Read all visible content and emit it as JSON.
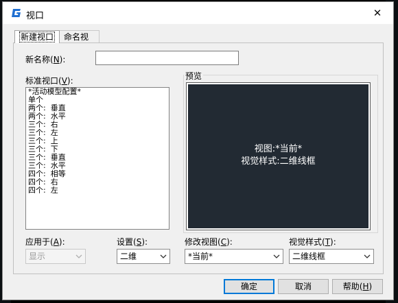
{
  "window": {
    "title": "视口",
    "close_symbol": "✕"
  },
  "tabs": [
    {
      "label": "新建视口",
      "active": true
    },
    {
      "label": "命名视口",
      "active": false
    }
  ],
  "new_name": {
    "label_prefix": "新名称(",
    "label_key": "N",
    "label_suffix": "):",
    "value": ""
  },
  "standard_viewports": {
    "label_prefix": "标准视口(",
    "label_key": "V",
    "label_suffix": "):",
    "items": [
      "*活动模型配置*",
      "单个",
      "两个:  垂直",
      "两个:  水平",
      "三个:  右",
      "三个:  左",
      "三个:  上",
      "三个:  下",
      "三个:  垂直",
      "三个:  水平",
      "四个:  相等",
      "四个:  右",
      "四个:  左"
    ]
  },
  "preview": {
    "group_label": "预览",
    "line1": "视图:*当前*",
    "line2": "视觉样式:二维线框",
    "screen_color": "#222a33"
  },
  "apply_to": {
    "label_prefix": "应用于(",
    "label_key": "A",
    "label_suffix": "):",
    "value": "显示",
    "enabled": false
  },
  "setup": {
    "label_prefix": "设置(",
    "label_key": "S",
    "label_suffix": "):",
    "value": "二维"
  },
  "change_view": {
    "label_prefix": "修改视图(",
    "label_key": "C",
    "label_suffix": "):",
    "value": "*当前*"
  },
  "visual_style": {
    "label_prefix": "视觉样式(",
    "label_key": "T",
    "label_suffix": "):",
    "value": "二维线框"
  },
  "buttons": {
    "ok": "确定",
    "cancel": "取消",
    "help_prefix": "帮助(",
    "help_key": "H",
    "help_suffix": ")"
  },
  "colors": {
    "accent": "#0078d7",
    "app_icon": "#1f6fd1"
  }
}
